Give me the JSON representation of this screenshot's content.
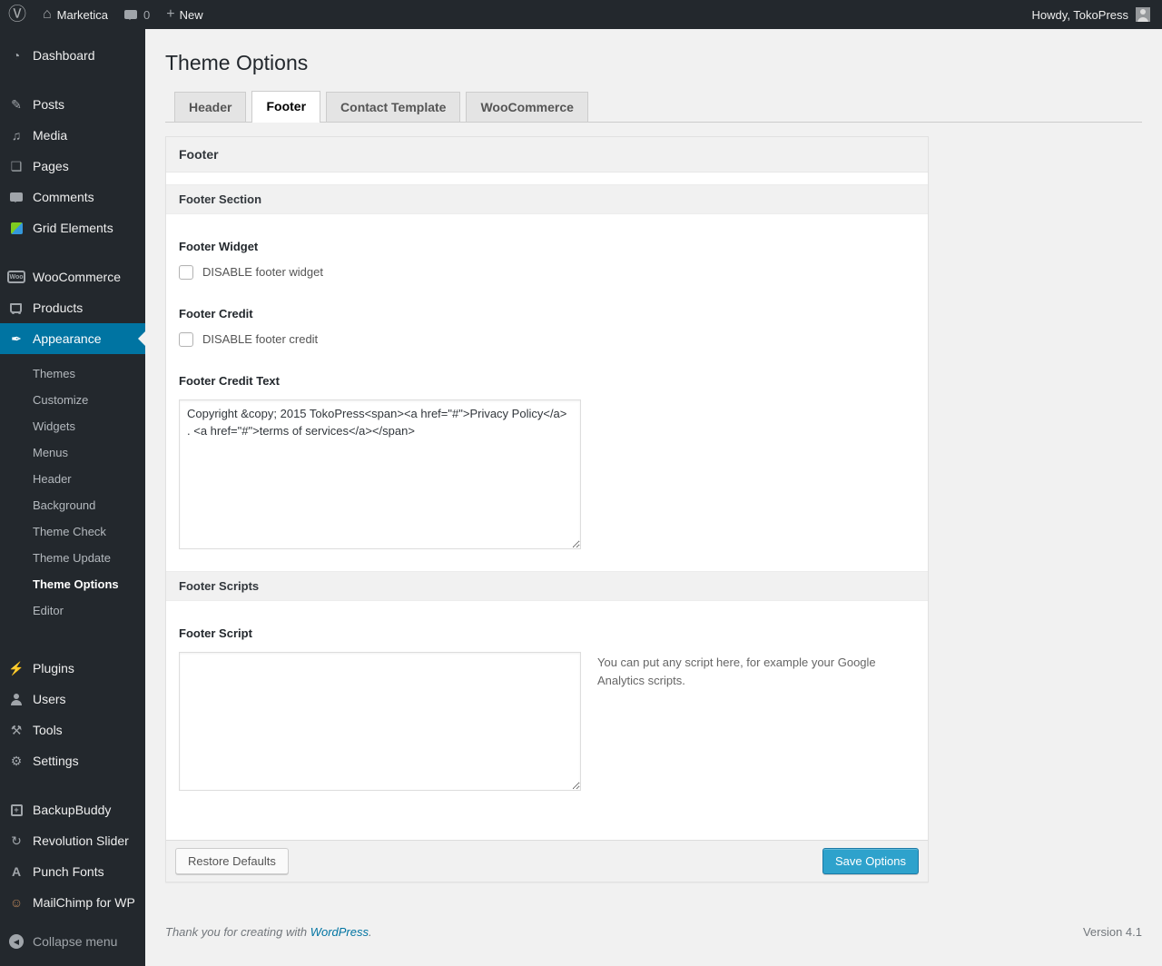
{
  "admin_bar": {
    "site_name": "Marketica",
    "comment_count": "0",
    "new_label": "New",
    "howdy": "Howdy, TokoPress"
  },
  "sidebar": {
    "items": [
      {
        "label": "Dashboard",
        "icon": "dashboard-icon"
      },
      {
        "label": "Posts",
        "icon": "pushpin-icon"
      },
      {
        "label": "Media",
        "icon": "media-icon"
      },
      {
        "label": "Pages",
        "icon": "pages-icon"
      },
      {
        "label": "Comments",
        "icon": "comment-icon"
      },
      {
        "label": "Grid Elements",
        "icon": "grid-elements-icon"
      },
      {
        "label": "WooCommerce",
        "icon": "woocommerce-icon"
      },
      {
        "label": "Products",
        "icon": "cart-icon"
      },
      {
        "label": "Appearance",
        "icon": "brush-icon",
        "active": true
      },
      {
        "label": "Plugins",
        "icon": "plugin-icon"
      },
      {
        "label": "Users",
        "icon": "user-icon"
      },
      {
        "label": "Tools",
        "icon": "tools-icon"
      },
      {
        "label": "Settings",
        "icon": "settings-icon"
      },
      {
        "label": "BackupBuddy",
        "icon": "backup-icon"
      },
      {
        "label": "Revolution Slider",
        "icon": "refresh-icon"
      },
      {
        "label": "Punch Fonts",
        "icon": "letter-a-icon"
      },
      {
        "label": "MailChimp for WP",
        "icon": "mailchimp-icon"
      },
      {
        "label": "Collapse menu",
        "icon": "collapse-icon"
      }
    ],
    "appearance_submenu": [
      {
        "label": "Themes",
        "current": false
      },
      {
        "label": "Customize",
        "current": false
      },
      {
        "label": "Widgets",
        "current": false
      },
      {
        "label": "Menus",
        "current": false
      },
      {
        "label": "Header",
        "current": false
      },
      {
        "label": "Background",
        "current": false
      },
      {
        "label": "Theme Check",
        "current": false
      },
      {
        "label": "Theme Update",
        "current": false
      },
      {
        "label": "Theme Options",
        "current": true
      },
      {
        "label": "Editor",
        "current": false
      }
    ]
  },
  "page": {
    "title": "Theme Options",
    "tabs": [
      {
        "label": "Header",
        "active": false
      },
      {
        "label": "Footer",
        "active": true
      },
      {
        "label": "Contact Template",
        "active": false
      },
      {
        "label": "WooCommerce",
        "active": false
      }
    ],
    "panel": {
      "heading": "Footer",
      "sections": [
        {
          "heading": "Footer Section",
          "fields": [
            {
              "label": "Footer Widget",
              "checkbox_label": "DISABLE footer widget",
              "checked": false
            },
            {
              "label": "Footer Credit",
              "checkbox_label": "DISABLE footer credit",
              "checked": false
            },
            {
              "label": "Footer Credit Text",
              "value": "Copyright &copy; 2015 TokoPress<span><a href=\"#\">Privacy Policy</a> . <a href=\"#\">terms of services</a></span>"
            }
          ]
        },
        {
          "heading": "Footer Scripts",
          "fields": [
            {
              "label": "Footer Script",
              "value": "",
              "help": "You can put any script here, for example your Google Analytics scripts."
            }
          ]
        }
      ],
      "actions": {
        "restore_label": "Restore Defaults",
        "save_label": "Save Options"
      }
    },
    "page_footer": {
      "thanks_prefix": "Thank you for creating with ",
      "wordpress_link": "WordPress",
      "thanks_suffix": ".",
      "version": "Version 4.1"
    }
  },
  "colors": {
    "admin_bar_bg": "#23282d",
    "sidebar_bg": "#23282d",
    "highlight": "#0074a2",
    "primary_button_bg": "#2ea2cc",
    "primary_button_border": "#1b7aa6",
    "page_bg": "#f1f1f1",
    "panel_bg": "#ffffff",
    "section_header_bg": "#f1f1f1",
    "link": "#0074a2"
  }
}
